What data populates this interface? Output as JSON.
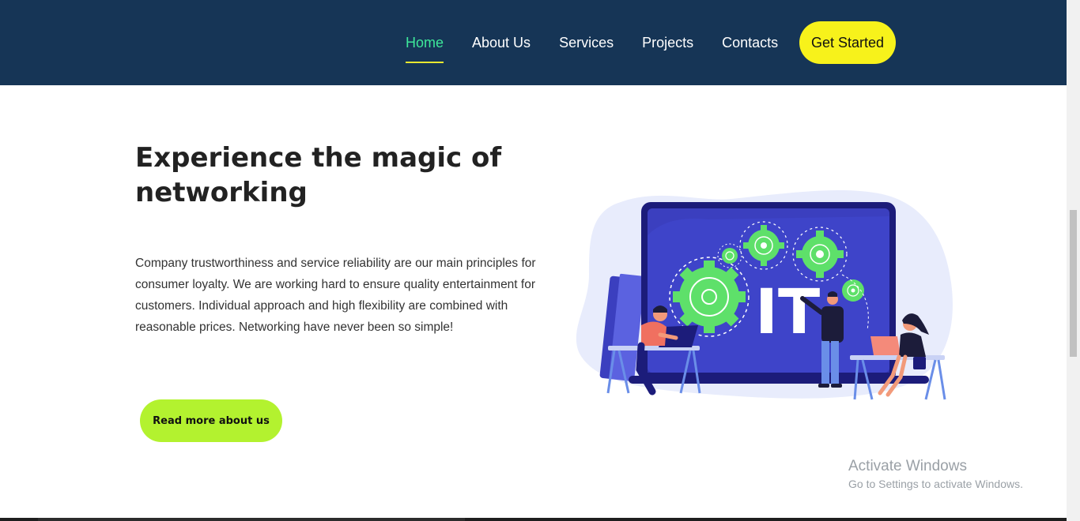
{
  "nav": {
    "links": [
      {
        "label": "Home",
        "active": true
      },
      {
        "label": "About Us"
      },
      {
        "label": "Services"
      },
      {
        "label": "Projects"
      },
      {
        "label": "Contacts"
      }
    ],
    "cta_label": "Get Started"
  },
  "hero": {
    "title": "Experience the magic of networking",
    "body": "Company trustworthiness and service reliability are our main principles for consumer loyalty. We are working hard to ensure quality entertainment for customers. Individual approach and high flexibility are combined with reasonable prices. Networking have never been so simple!",
    "button_label": "Read more about us",
    "illustration_text": "IT"
  },
  "watermark": {
    "title": "Activate Windows",
    "subtitle": "Go to Settings to activate Windows."
  },
  "colors": {
    "nav_bg": "#163556",
    "nav_active": "#3ee89a",
    "cta_bg": "#f7f21b",
    "read_more_bg": "#b3f22f"
  }
}
